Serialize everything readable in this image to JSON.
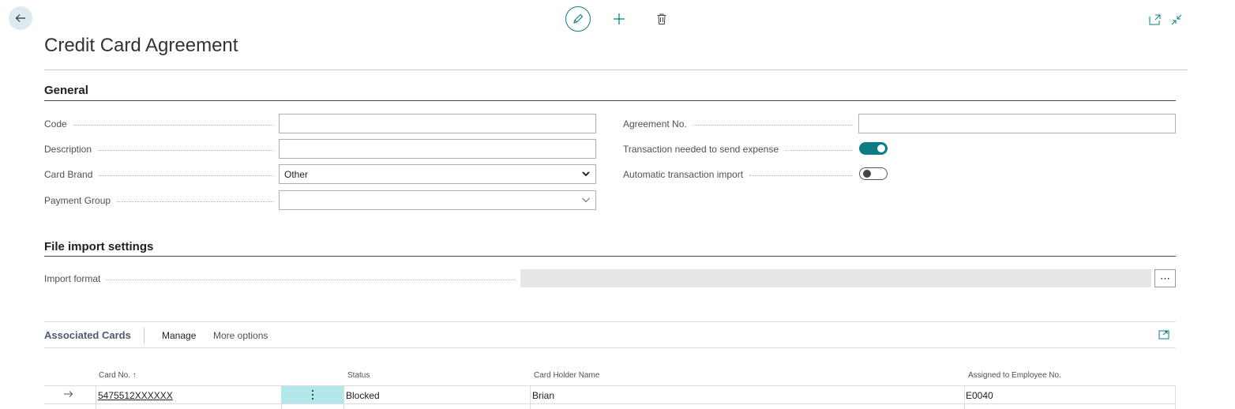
{
  "header": {
    "title": "Credit Card Agreement",
    "icons": {
      "back": "arrow-left-icon",
      "edit": "pencil-icon",
      "new": "plus-icon",
      "delete": "trash-icon",
      "open_new": "open-in-new-window-icon",
      "collapse": "collapse-icon"
    },
    "accent": "#0f7b86"
  },
  "general": {
    "title": "General",
    "left_fields": [
      {
        "label": "Code",
        "value": ""
      },
      {
        "label": "Description",
        "value": ""
      },
      {
        "label": "Card Brand",
        "value": "Other"
      },
      {
        "label": "Payment Group",
        "value": ""
      }
    ],
    "right_fields": [
      {
        "label": "Agreement No.",
        "value": ""
      },
      {
        "label": "Transaction needed to send expense",
        "toggle": true
      },
      {
        "label": "Automatic transaction import",
        "toggle": false
      }
    ]
  },
  "file_import": {
    "title": "File import settings",
    "import_format_label": "Import format",
    "import_format_value": "",
    "lookup_label": "⋯"
  },
  "associated_cards": {
    "title": "Associated Cards",
    "actions": {
      "manage": "Manage",
      "more": "More options"
    },
    "columns": [
      "Card No. ↑",
      "Status",
      "Card Holder Name",
      "Assigned to Employee No."
    ],
    "rows": [
      {
        "card_no": "5475512XXXXXX",
        "status": "Blocked",
        "card_holder_name": "Brian",
        "employee_no": "E0040"
      }
    ]
  }
}
